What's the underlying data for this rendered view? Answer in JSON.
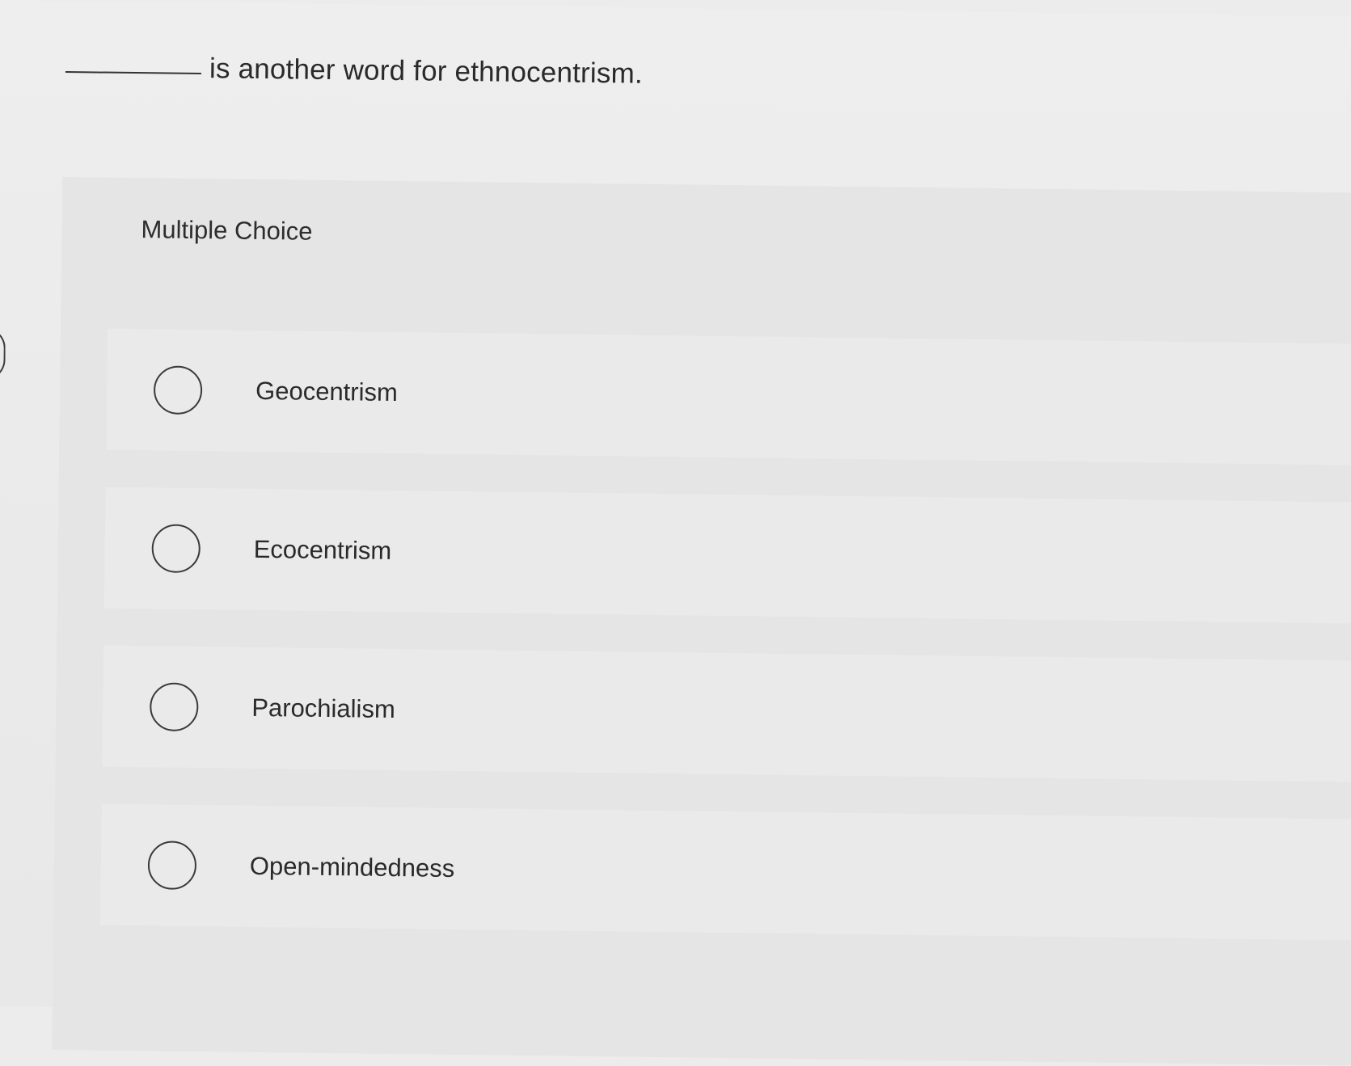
{
  "question": {
    "text": "is another word for ethnocentrism."
  },
  "multiple_choice": {
    "label": "Multiple Choice",
    "options": [
      {
        "label": "Geocentrism",
        "selected": false
      },
      {
        "label": "Ecocentrism",
        "selected": false
      },
      {
        "label": "Parochialism",
        "selected": false
      },
      {
        "label": "Open-mindedness",
        "selected": false
      }
    ]
  }
}
